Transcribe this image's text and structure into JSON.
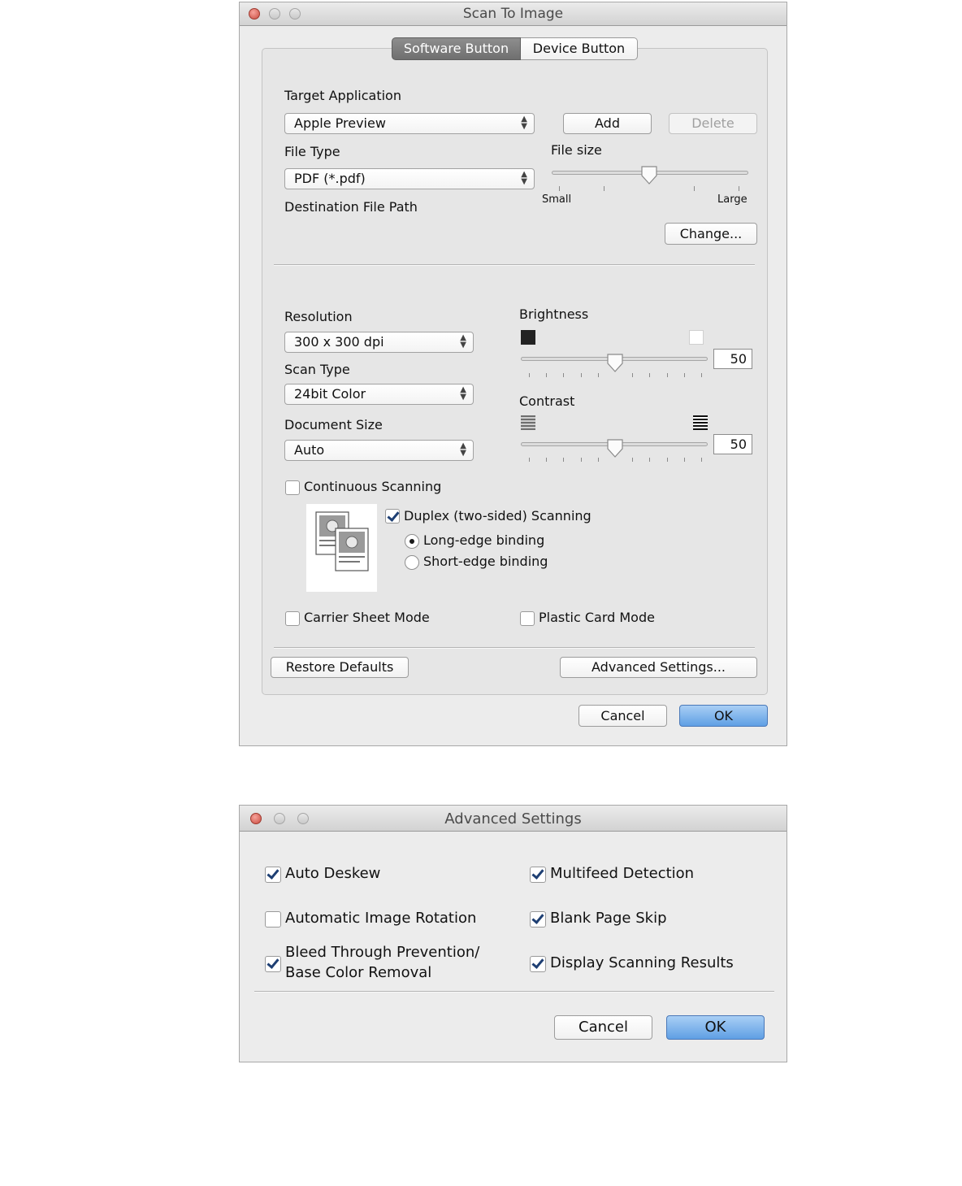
{
  "scan_window": {
    "title": "Scan To Image",
    "tabs": [
      {
        "label": "Software Button",
        "selected": true
      },
      {
        "label": "Device Button",
        "selected": false
      }
    ],
    "target_application": {
      "label": "Target Application",
      "value": "Apple Preview",
      "add_label": "Add",
      "delete_label": "Delete"
    },
    "file_type": {
      "label": "File Type",
      "value": "PDF (*.pdf)"
    },
    "file_size": {
      "label": "File size",
      "min_label": "Small",
      "max_label": "Large",
      "level": 0.5
    },
    "destination": {
      "label": "Destination File Path",
      "change_label": "Change..."
    },
    "resolution": {
      "label": "Resolution",
      "value": "300 x 300 dpi"
    },
    "scan_type": {
      "label": "Scan Type",
      "value": "24bit Color"
    },
    "document_size": {
      "label": "Document Size",
      "value": "Auto"
    },
    "brightness": {
      "label": "Brightness",
      "value": "50"
    },
    "contrast": {
      "label": "Contrast",
      "value": "50"
    },
    "continuous_scanning": {
      "label": "Continuous Scanning",
      "checked": false
    },
    "duplex": {
      "label": "Duplex (two-sided) Scanning",
      "checked": true,
      "long_edge": "Long-edge binding",
      "short_edge": "Short-edge binding",
      "selected": "long"
    },
    "carrier_sheet": {
      "label": "Carrier Sheet Mode",
      "checked": false
    },
    "plastic_card": {
      "label": "Plastic Card Mode",
      "checked": false
    },
    "restore_label": "Restore Defaults",
    "advanced_label": "Advanced Settings...",
    "cancel_label": "Cancel",
    "ok_label": "OK"
  },
  "advanced_window": {
    "title": "Advanced Settings",
    "options": {
      "auto_deskew": {
        "label": "Auto Deskew",
        "checked": true
      },
      "multifeed": {
        "label": "Multifeed Detection",
        "checked": true
      },
      "auto_rotation": {
        "label": "Automatic Image Rotation",
        "checked": false
      },
      "blank_page": {
        "label": "Blank Page Skip",
        "checked": true
      },
      "bleed_line1": "Bleed Through Prevention/",
      "bleed_line2": "Base Color Removal",
      "bleed_checked": true,
      "display_results": {
        "label": "Display Scanning Results",
        "checked": true
      }
    },
    "cancel_label": "Cancel",
    "ok_label": "OK"
  }
}
